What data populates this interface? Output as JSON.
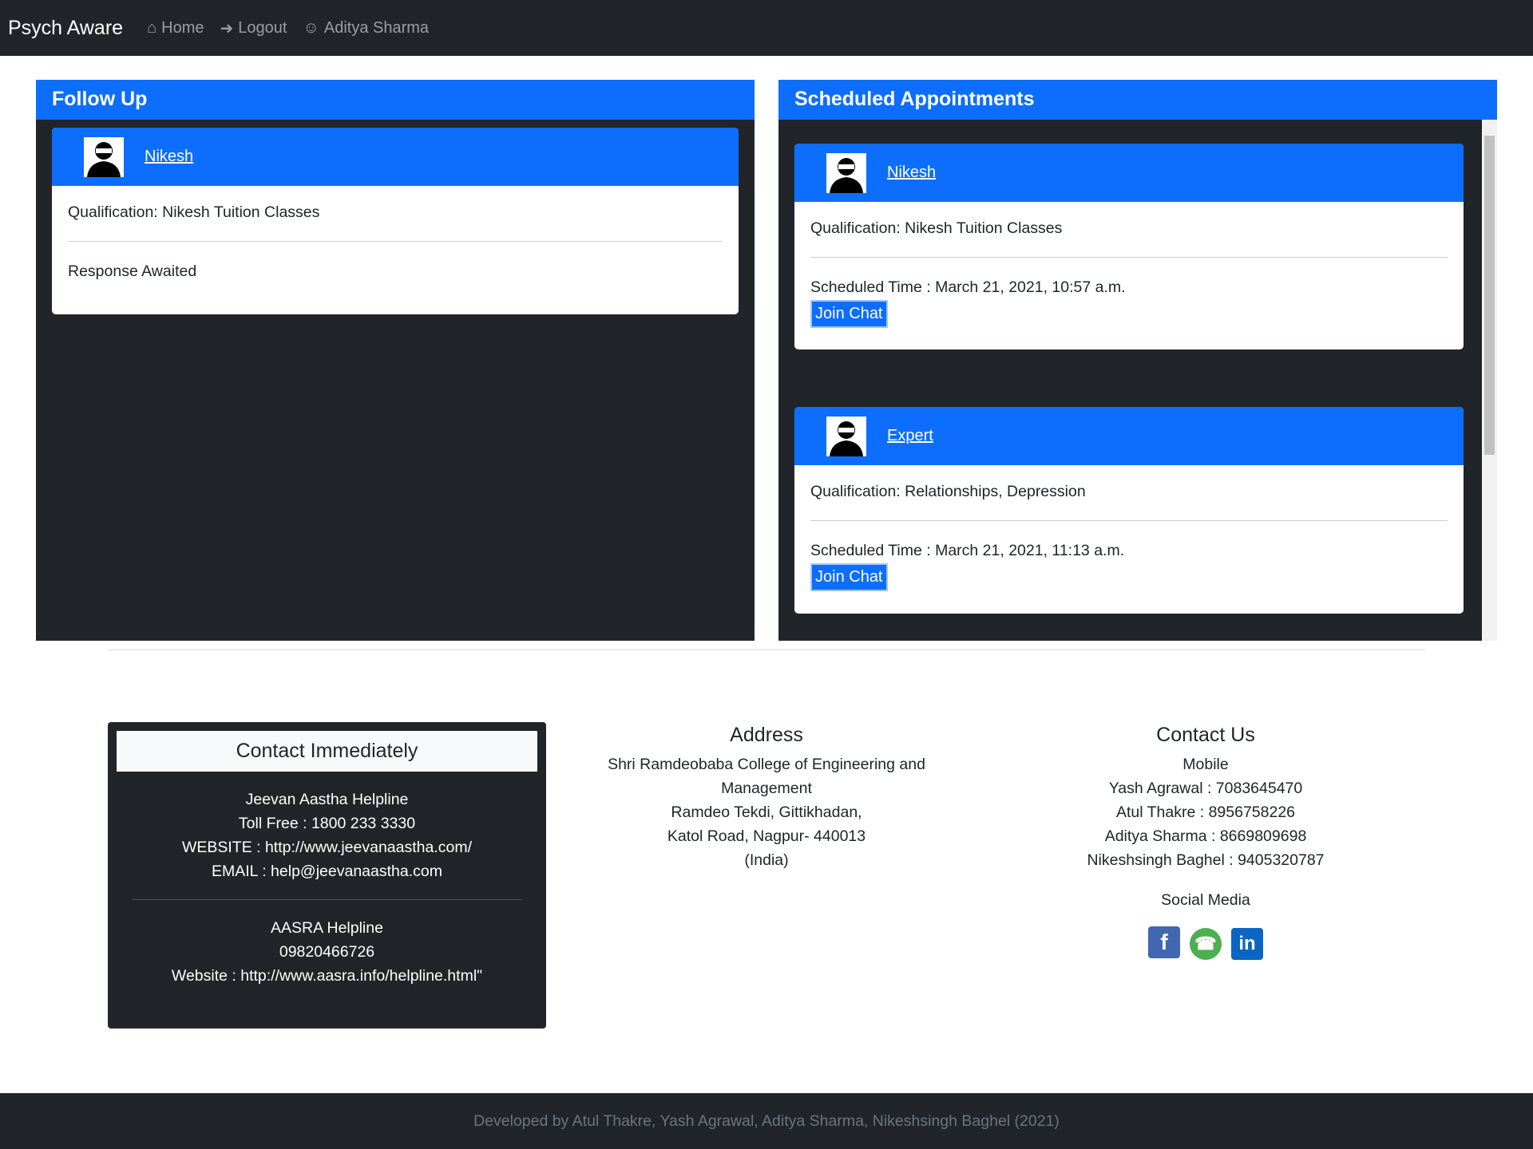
{
  "nav": {
    "brand": "Psych Aware",
    "home": "Home",
    "logout": "Logout",
    "user": "Aditya Sharma"
  },
  "follow_up": {
    "title": "Follow Up",
    "cards": [
      {
        "name": "Nikesh",
        "qualification": "Qualification: Nikesh Tuition Classes",
        "status": "Response Awaited"
      }
    ]
  },
  "appointments": {
    "title": "Scheduled Appointments",
    "cards": [
      {
        "name": "Nikesh",
        "qualification": "Qualification: Nikesh Tuition Classes",
        "time": "Scheduled Time : March 21, 2021, 10:57 a.m.",
        "button": "Join Chat"
      },
      {
        "name": "Expert",
        "qualification": "Qualification: Relationships, Depression",
        "time": "Scheduled Time : March 21, 2021, 11:13 a.m.",
        "button": "Join Chat"
      }
    ]
  },
  "contact_immediately": {
    "title": "Contact Immediately",
    "lines1": [
      "Jeevan Aastha Helpline",
      "Toll Free : 1800 233 3330",
      "WEBSITE : http://www.jeevanaastha.com/",
      "EMAIL : help@jeevanaastha.com"
    ],
    "lines2": [
      "AASRA Helpline",
      "09820466726",
      "Website : http://www.aasra.info/helpline.html\""
    ]
  },
  "address": {
    "title": "Address",
    "lines": [
      "Shri Ramdeobaba College of Engineering and Management",
      "Ramdeo Tekdi, Gittikhadan,",
      "Katol Road, Nagpur- 440013",
      "(India)"
    ]
  },
  "contact_us": {
    "title": "Contact Us",
    "mobile": "Mobile",
    "lines": [
      "Yash Agrawal : 7083645470",
      "Atul Thakre : 8956758226",
      "Aditya Sharma : 8669809698",
      "Nikeshsingh Baghel : 9405320787"
    ],
    "social": "Social Media"
  },
  "footer": "Developed by Atul Thakre, Yash Agrawal, Aditya Sharma, Nikeshsingh Baghel (2021)"
}
